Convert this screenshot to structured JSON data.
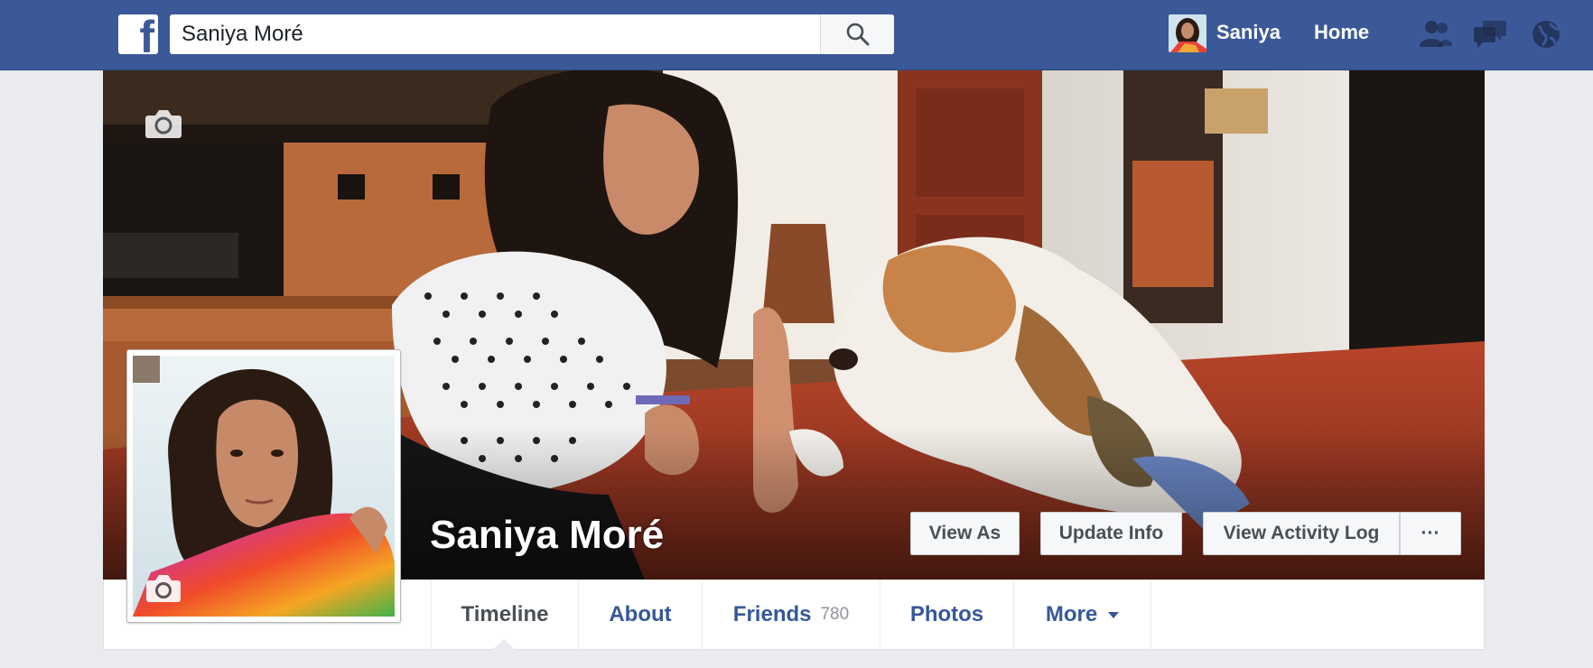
{
  "topbar": {
    "logo_icon": "facebook-f-logo",
    "search_value": "Saniya Moré",
    "search_icon": "magnifier-icon",
    "user_name": "Saniya",
    "home_label": "Home",
    "icons": [
      "friend-requests-icon",
      "messages-icon",
      "notifications-globe-icon"
    ],
    "brand_color": "#3b5998"
  },
  "cover": {
    "profile_name": "Saniya Moré",
    "buttons": {
      "view_as": "View As",
      "update_info": "Update Info",
      "activity_log": "View Activity Log",
      "more": "···"
    }
  },
  "tabs": {
    "timeline": "Timeline",
    "about": "About",
    "friends": "Friends",
    "friends_count": "780",
    "photos": "Photos",
    "more": "More",
    "active": "Timeline"
  }
}
